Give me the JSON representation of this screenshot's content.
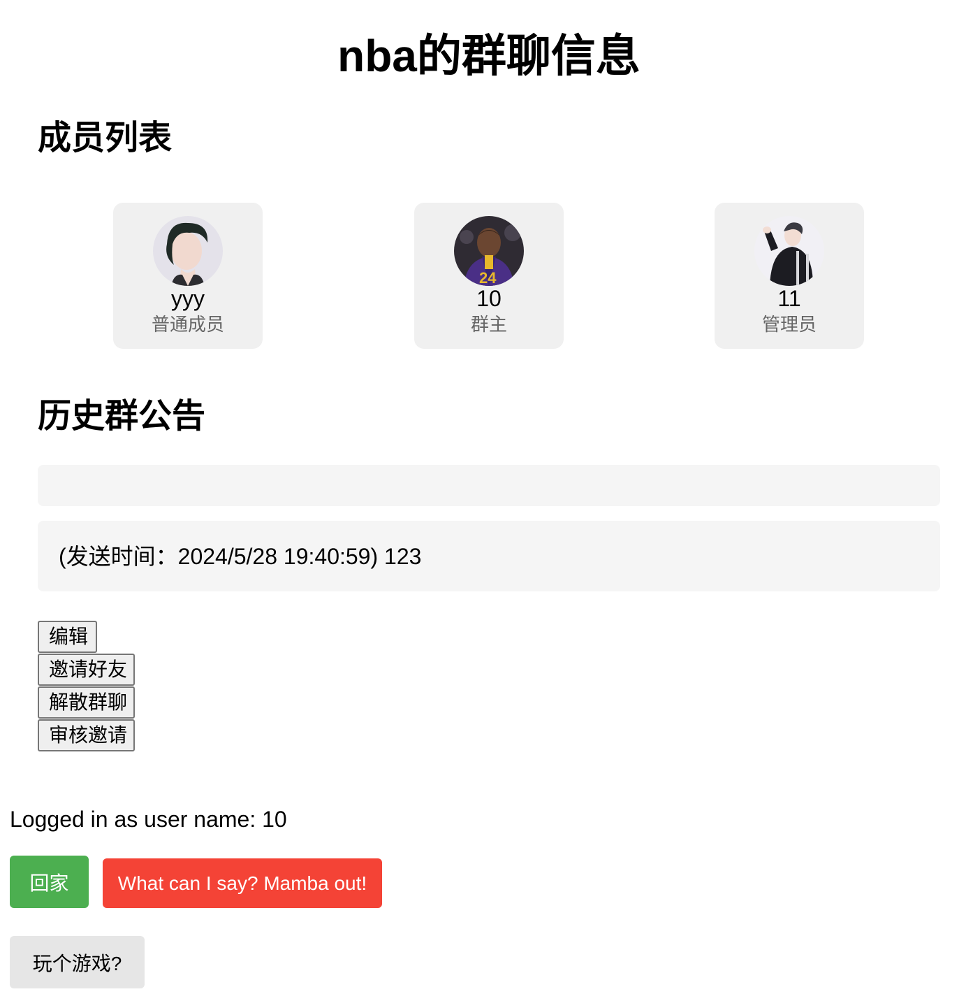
{
  "page": {
    "title": "nba的群聊信息"
  },
  "members_section": {
    "heading": "成员列表",
    "members": [
      {
        "name": "yyy",
        "role": "普通成员",
        "avatar": "avatar-photo-person-dark-hair"
      },
      {
        "name": "10",
        "role": "群主",
        "avatar": "avatar-photo-basketball-player"
      },
      {
        "name": "11",
        "role": "管理员",
        "avatar": "avatar-photo-person-black-outfit"
      }
    ]
  },
  "announcements_section": {
    "heading": "历史群公告",
    "items": [
      {
        "text": ""
      },
      {
        "text": "(发送时间：2024/5/28 19:40:59) 123"
      }
    ]
  },
  "group_actions": {
    "edit": "编辑",
    "invite_friend": "邀请好友",
    "disband_group": "解散群聊",
    "review_invites": "审核邀请"
  },
  "footer": {
    "logged_in_text": "Logged in as user name: 10",
    "home_button": "回家",
    "mamba_button": "What can I say? Mamba out!",
    "game_button": "玩个游戏?"
  },
  "colors": {
    "card_bg": "#f0f0f0",
    "notice_bg": "#f5f5f5",
    "home_green": "#4caf50",
    "mamba_red": "#f44336",
    "game_gray": "#e6e6e6",
    "role_gray": "#666666"
  }
}
